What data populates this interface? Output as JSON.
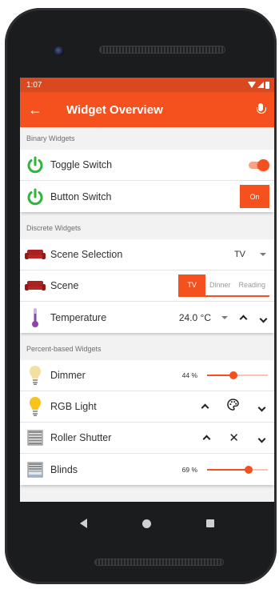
{
  "status_bar": {
    "time": "1:07"
  },
  "app_bar": {
    "title": "Widget Overview",
    "back_icon": "arrow-left-icon",
    "action_icon": "microphone-icon"
  },
  "colors": {
    "accent": "#f4511e",
    "status_bar": "#d9481f",
    "background": "#f2f2f2"
  },
  "sections": {
    "binary": {
      "header": "Binary Widgets",
      "toggle": {
        "label": "Toggle Switch",
        "icon": "power-icon",
        "state": true
      },
      "button": {
        "label": "Button Switch",
        "icon": "power-icon",
        "button_label": "On"
      }
    },
    "discrete": {
      "header": "Discrete Widgets",
      "scene_selection": {
        "label": "Scene Selection",
        "icon": "sofa-icon",
        "value": "TV"
      },
      "scene": {
        "label": "Scene",
        "icon": "sofa-icon",
        "options": [
          "TV",
          "Dinner",
          "Reading"
        ],
        "selected": "TV"
      },
      "temperature": {
        "label": "Temperature",
        "icon": "thermometer-icon",
        "value": "24.0 °C"
      }
    },
    "percent": {
      "header": "Percent-based Widgets",
      "dimmer": {
        "label": "Dimmer",
        "icon": "bulb-icon",
        "value": "44 %",
        "level": 0.44
      },
      "rgb": {
        "label": "RGB Light",
        "icon": "bulb-on-icon"
      },
      "roller": {
        "label": "Roller Shutter",
        "icon": "shutter-icon"
      },
      "blinds": {
        "label": "Blinds",
        "icon": "blinds-icon",
        "value": "69 %",
        "level": 0.69
      }
    }
  }
}
